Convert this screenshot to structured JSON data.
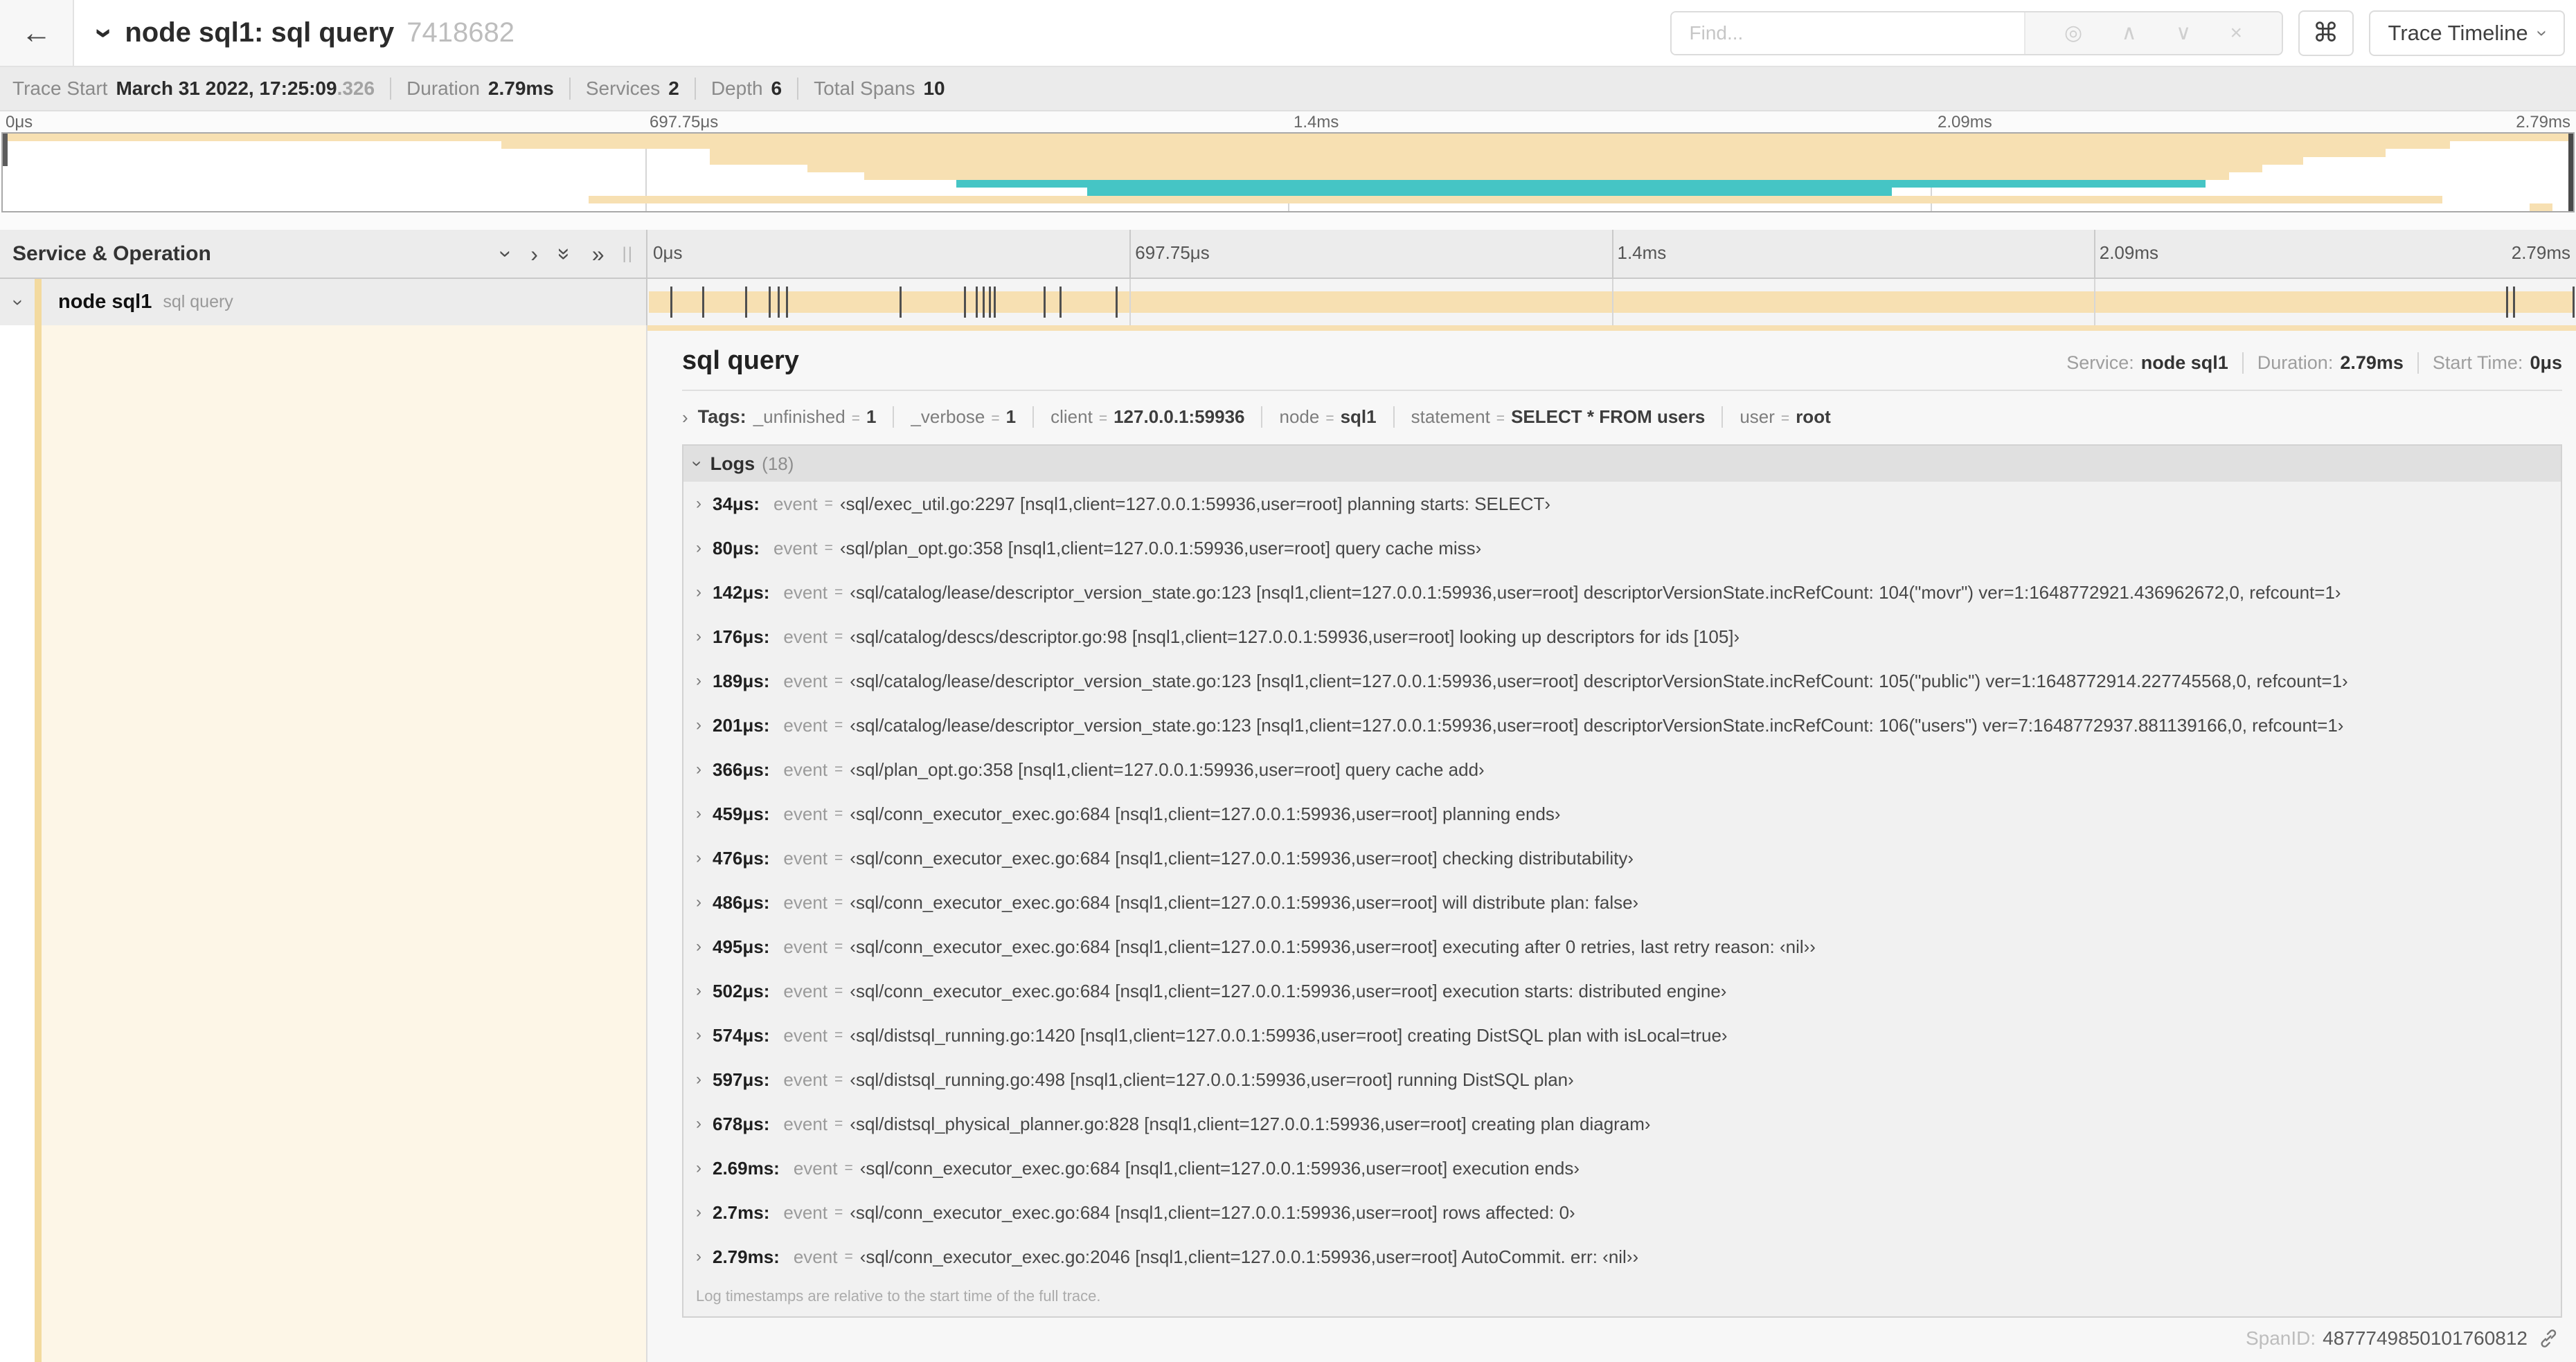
{
  "colors": {
    "tan": "#F7E0B2",
    "teal": "#45C5C5",
    "accent": "#F3DA9F",
    "cream": "#FDF6E7"
  },
  "icons": {
    "back": "←",
    "chevron": "›",
    "dbl_chevron": "»",
    "target": "◎",
    "up": "∧",
    "down": "∨",
    "close": "×",
    "resizer": "||"
  },
  "misc": {
    "eq": "="
  },
  "header": {
    "title": "node sql1: sql query",
    "trace_id": "7418682",
    "find_placeholder": "Find...",
    "keyboard_shortcut": "⌘",
    "view_selector_label": "Trace Timeline"
  },
  "summary": {
    "items": [
      {
        "label": "Trace Start",
        "value": "March 31 2022, 17:25:09",
        "suffix": ".326"
      },
      {
        "label": "Duration",
        "value": "2.79ms",
        "suffix": ""
      },
      {
        "label": "Services",
        "value": "2",
        "suffix": ""
      },
      {
        "label": "Depth",
        "value": "6",
        "suffix": ""
      },
      {
        "label": "Total Spans",
        "value": "10",
        "suffix": ""
      }
    ]
  },
  "timeline_ticks": [
    {
      "label": "0μs",
      "pct": 0
    },
    {
      "label": "697.75μs",
      "pct": 25
    },
    {
      "label": "1.4ms",
      "pct": 50
    },
    {
      "label": "2.09ms",
      "pct": 75
    },
    {
      "label": "2.79ms",
      "pct": 100
    }
  ],
  "minimap": {
    "spans": [
      {
        "start": 0,
        "end": 100,
        "color": "tan"
      },
      {
        "start": 19.4,
        "end": 95.2,
        "color": "tan"
      },
      {
        "start": 27.5,
        "end": 92.7,
        "color": "tan"
      },
      {
        "start": 27.5,
        "end": 89.5,
        "color": "tan"
      },
      {
        "start": 31.3,
        "end": 87.9,
        "color": "tan"
      },
      {
        "start": 33.5,
        "end": 86.6,
        "color": "tan"
      },
      {
        "start": 37.1,
        "end": 85.7,
        "color": "teal"
      },
      {
        "start": 42.2,
        "end": 73.5,
        "color": "teal"
      },
      {
        "start": 22.8,
        "end": 94.9,
        "color": "tan"
      },
      {
        "start": 98.3,
        "end": 99.2,
        "color": "tan"
      }
    ]
  },
  "timeline": {
    "left_header": "Service & Operation",
    "service": "node sql1",
    "operation": "sql query",
    "total_us": 2790,
    "log_markers_us": [
      34,
      80,
      142,
      176,
      189,
      201,
      366,
      459,
      476,
      486,
      495,
      502,
      574,
      597,
      678,
      2690,
      2700,
      2790
    ]
  },
  "detail": {
    "title": "sql query",
    "kv": [
      {
        "label": "Service:",
        "value": "node sql1"
      },
      {
        "label": "Duration:",
        "value": "2.79ms"
      },
      {
        "label": "Start Time:",
        "value": "0μs"
      }
    ],
    "tags_label": "Tags:",
    "tags": [
      {
        "key": "_unfinished",
        "value": "1"
      },
      {
        "key": "_verbose",
        "value": "1"
      },
      {
        "key": "client",
        "value": "127.0.0.1:59936"
      },
      {
        "key": "node",
        "value": "sql1"
      },
      {
        "key": "statement",
        "value": "SELECT * FROM users"
      },
      {
        "key": "user",
        "value": "root"
      }
    ],
    "logs_label": "Logs",
    "logs_count": "(18)",
    "logs": [
      {
        "t": "34μs:",
        "field": "event",
        "value": "‹sql/exec_util.go:2297 [nsql1,client=127.0.0.1:59936,user=root] planning starts: SELECT›"
      },
      {
        "t": "80μs:",
        "field": "event",
        "value": "‹sql/plan_opt.go:358 [nsql1,client=127.0.0.1:59936,user=root] query cache miss›"
      },
      {
        "t": "142μs:",
        "field": "event",
        "value": "‹sql/catalog/lease/descriptor_version_state.go:123 [nsql1,client=127.0.0.1:59936,user=root] descriptorVersionState.incRefCount: 104(\"movr\") ver=1:1648772921.436962672,0, refcount=1›"
      },
      {
        "t": "176μs:",
        "field": "event",
        "value": "‹sql/catalog/descs/descriptor.go:98 [nsql1,client=127.0.0.1:59936,user=root] looking up descriptors for ids [105]›"
      },
      {
        "t": "189μs:",
        "field": "event",
        "value": "‹sql/catalog/lease/descriptor_version_state.go:123 [nsql1,client=127.0.0.1:59936,user=root] descriptorVersionState.incRefCount: 105(\"public\") ver=1:1648772914.227745568,0, refcount=1›"
      },
      {
        "t": "201μs:",
        "field": "event",
        "value": "‹sql/catalog/lease/descriptor_version_state.go:123 [nsql1,client=127.0.0.1:59936,user=root] descriptorVersionState.incRefCount: 106(\"users\") ver=7:1648772937.881139166,0, refcount=1›"
      },
      {
        "t": "366μs:",
        "field": "event",
        "value": "‹sql/plan_opt.go:358 [nsql1,client=127.0.0.1:59936,user=root] query cache add›"
      },
      {
        "t": "459μs:",
        "field": "event",
        "value": "‹sql/conn_executor_exec.go:684 [nsql1,client=127.0.0.1:59936,user=root] planning ends›"
      },
      {
        "t": "476μs:",
        "field": "event",
        "value": "‹sql/conn_executor_exec.go:684 [nsql1,client=127.0.0.1:59936,user=root] checking distributability›"
      },
      {
        "t": "486μs:",
        "field": "event",
        "value": "‹sql/conn_executor_exec.go:684 [nsql1,client=127.0.0.1:59936,user=root] will distribute plan: false›"
      },
      {
        "t": "495μs:",
        "field": "event",
        "value": "‹sql/conn_executor_exec.go:684 [nsql1,client=127.0.0.1:59936,user=root] executing after 0 retries, last retry reason: ‹nil››"
      },
      {
        "t": "502μs:",
        "field": "event",
        "value": "‹sql/conn_executor_exec.go:684 [nsql1,client=127.0.0.1:59936,user=root] execution starts: distributed engine›"
      },
      {
        "t": "574μs:",
        "field": "event",
        "value": "‹sql/distsql_running.go:1420 [nsql1,client=127.0.0.1:59936,user=root] creating DistSQL plan with isLocal=true›"
      },
      {
        "t": "597μs:",
        "field": "event",
        "value": "‹sql/distsql_running.go:498 [nsql1,client=127.0.0.1:59936,user=root] running DistSQL plan›"
      },
      {
        "t": "678μs:",
        "field": "event",
        "value": "‹sql/distsql_physical_planner.go:828 [nsql1,client=127.0.0.1:59936,user=root] creating plan diagram›"
      },
      {
        "t": "2.69ms:",
        "field": "event",
        "value": "‹sql/conn_executor_exec.go:684 [nsql1,client=127.0.0.1:59936,user=root] execution ends›"
      },
      {
        "t": "2.7ms:",
        "field": "event",
        "value": "‹sql/conn_executor_exec.go:684 [nsql1,client=127.0.0.1:59936,user=root] rows affected: 0›"
      },
      {
        "t": "2.79ms:",
        "field": "event",
        "value": "‹sql/conn_executor_exec.go:2046 [nsql1,client=127.0.0.1:59936,user=root] AutoCommit. err: ‹nil››"
      }
    ],
    "footnote": "Log timestamps are relative to the start time of the full trace.",
    "spanid_label": "SpanID:",
    "spanid_value": "4877749850101760812"
  }
}
